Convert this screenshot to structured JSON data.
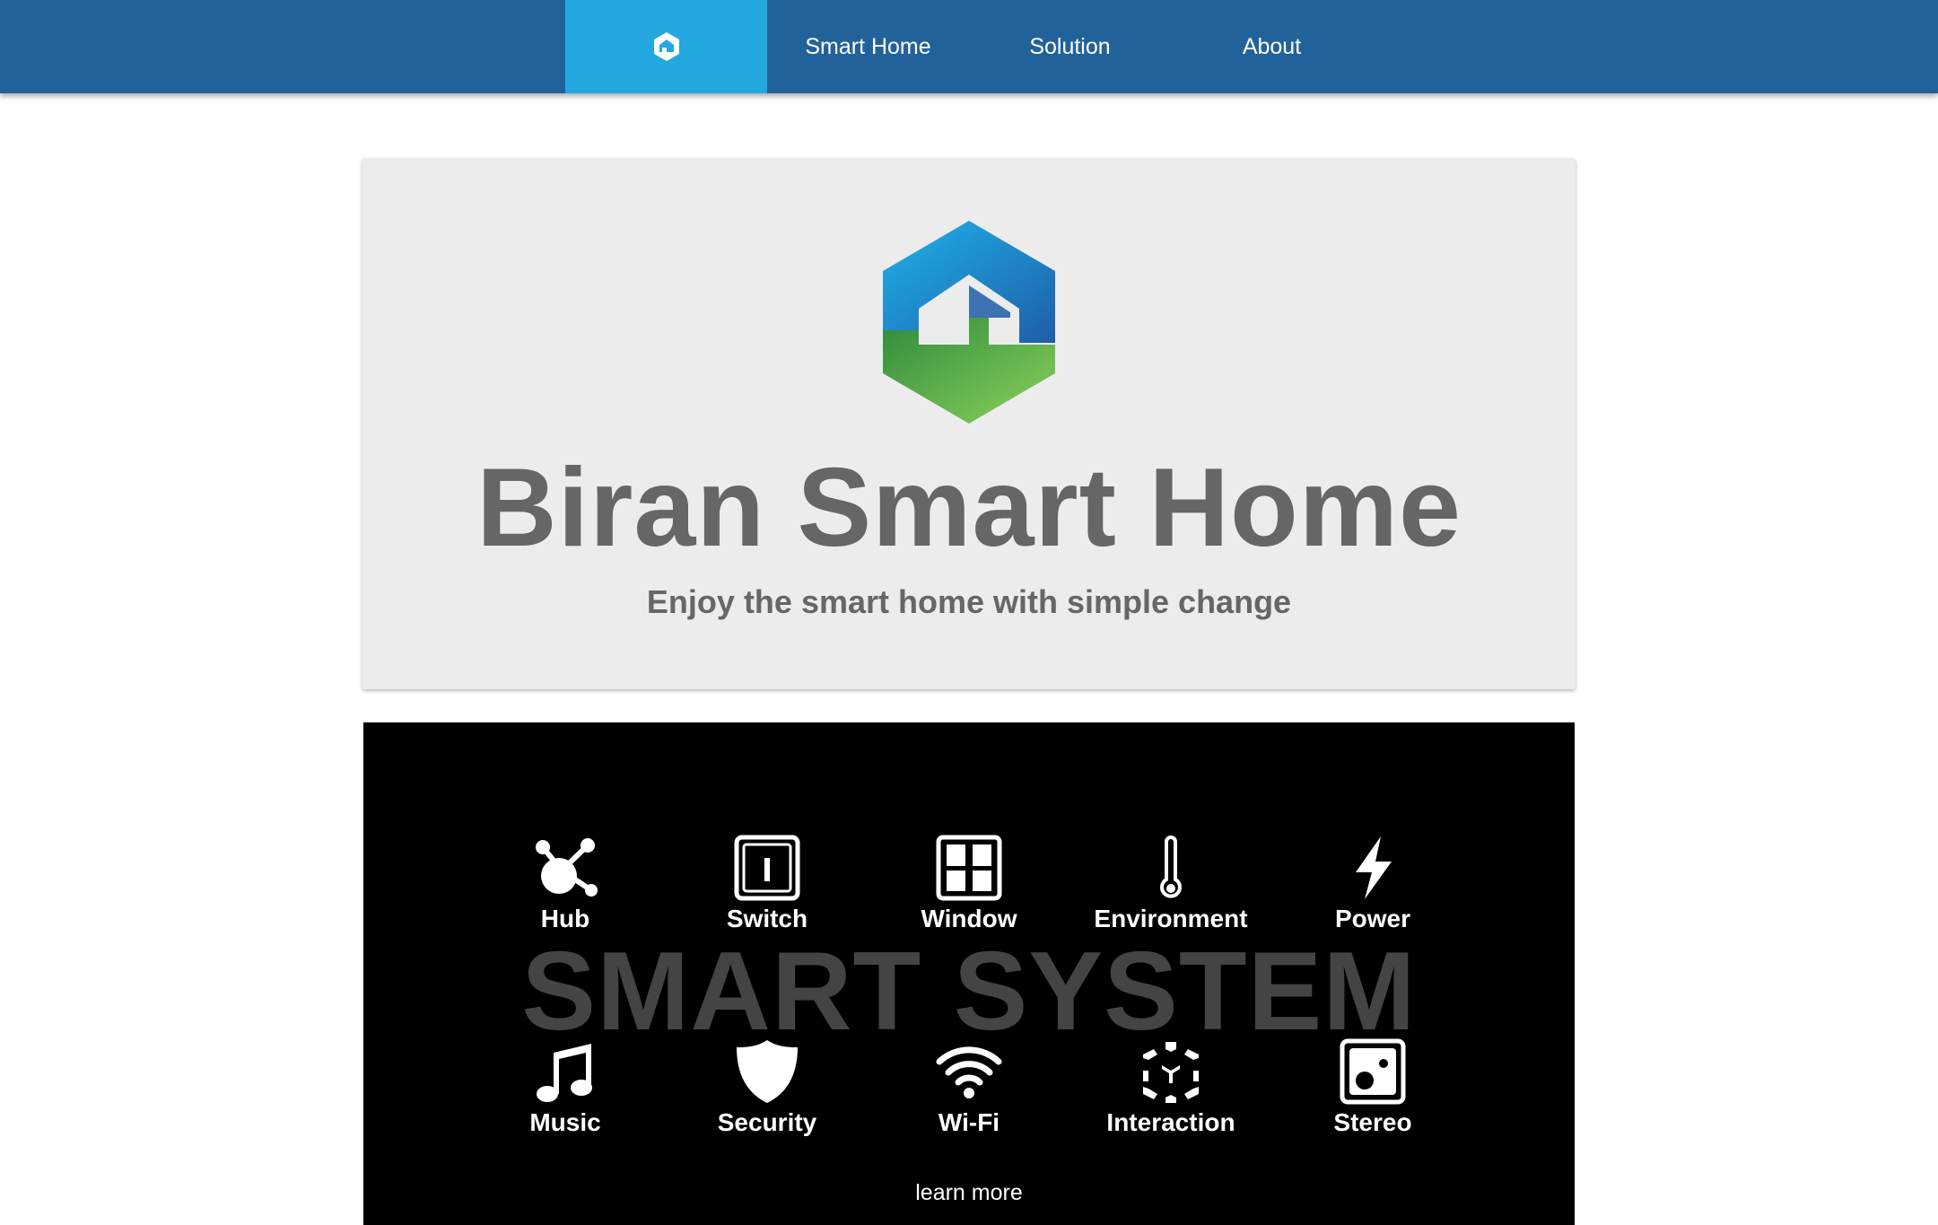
{
  "colors": {
    "nav_bg": "#22629b",
    "nav_active": "#22a8df",
    "hero_bg": "#ececec",
    "hero_text": "#666666",
    "system_bg": "#000000",
    "system_watermark": "#444444",
    "logo_blue": "#2196d9",
    "logo_green": "#5ab447"
  },
  "nav": {
    "logo_icon": "house-hexagon-icon",
    "items": [
      {
        "label": "Smart Home"
      },
      {
        "label": "Solution"
      },
      {
        "label": "About"
      }
    ]
  },
  "hero": {
    "logo_icon": "house-hexagon-logo",
    "title": "Biran Smart Home",
    "subtitle": "Enjoy the smart home with simple change"
  },
  "system": {
    "watermark": "SMART SYSTEM",
    "features": [
      {
        "label": "Hub",
        "icon": "hub-icon"
      },
      {
        "label": "Switch",
        "icon": "switch-icon"
      },
      {
        "label": "Window",
        "icon": "window-icon"
      },
      {
        "label": "Environment",
        "icon": "thermometer-icon"
      },
      {
        "label": "Power",
        "icon": "lightning-icon"
      },
      {
        "label": "Music",
        "icon": "music-note-icon"
      },
      {
        "label": "Security",
        "icon": "shield-icon"
      },
      {
        "label": "Wi-Fi",
        "icon": "wifi-icon"
      },
      {
        "label": "Interaction",
        "icon": "cube-icon"
      },
      {
        "label": "Stereo",
        "icon": "speaker-icon"
      }
    ],
    "learn_more": "learn more"
  }
}
